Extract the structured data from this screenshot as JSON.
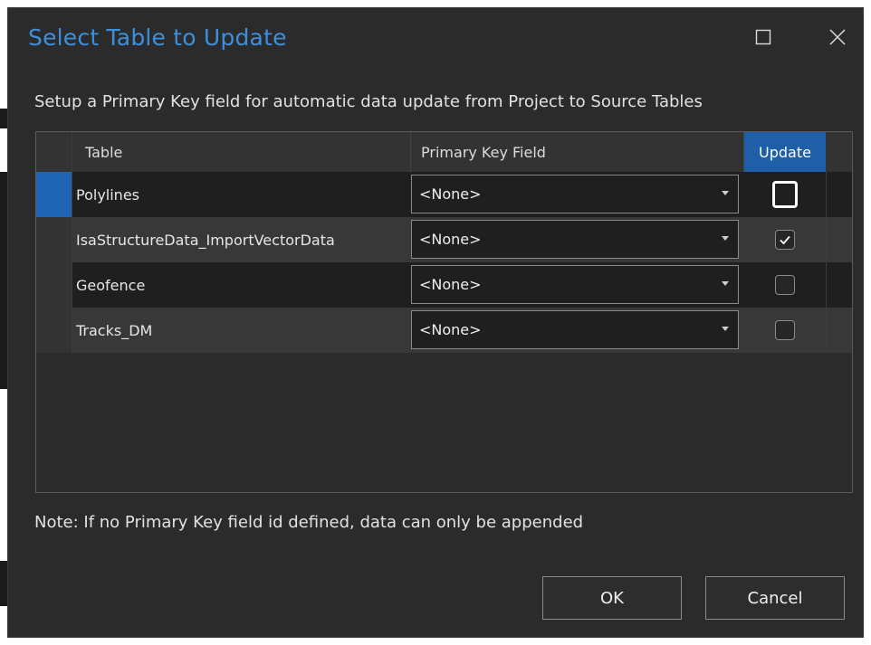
{
  "dialog": {
    "title": "Select Table to Update",
    "description": "Setup a Primary Key field for automatic data update from Project to Source Tables",
    "note": "Note: If no Primary Key field id defined, data can only be appended",
    "accent_color": "#3d8fdc",
    "selection_color": "#1f63b4"
  },
  "window_controls": {
    "maximize_icon": "maximize-icon",
    "close_icon": "close-icon"
  },
  "grid": {
    "columns": {
      "table": "Table",
      "primary_key": "Primary Key Field",
      "update": "Update"
    },
    "rows": [
      {
        "table": "Polylines",
        "primary_key": "<None>",
        "update": false,
        "selected": true
      },
      {
        "table": "IsaStructureData_ImportVectorData",
        "primary_key": "<None>",
        "update": true,
        "selected": false
      },
      {
        "table": "Geofence",
        "primary_key": "<None>",
        "update": false,
        "selected": false
      },
      {
        "table": "Tracks_DM",
        "primary_key": "<None>",
        "update": false,
        "selected": false
      }
    ]
  },
  "buttons": {
    "ok": "OK",
    "cancel": "Cancel"
  }
}
